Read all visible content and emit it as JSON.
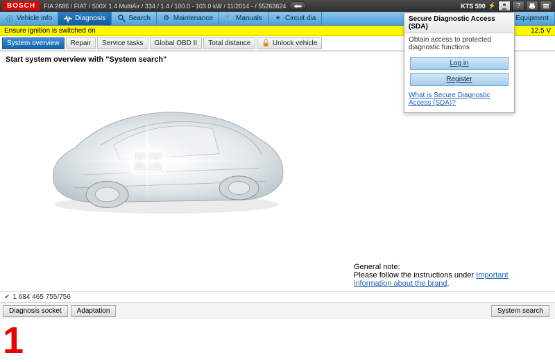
{
  "brand": "BOSCH",
  "vehicle_string": "FIA 2686 / FIAT / 500X 1.4 MultiAir / 334 / 1.4 / 100.0 - 103.0 kW / 11/2014 - / 55263624",
  "device": "KTS 590",
  "nav": {
    "vehicle_info": "Vehicle info",
    "diagnosis": "Diagnosis",
    "search": "Search",
    "maintenance": "Maintenance",
    "manuals": "Manuals",
    "circuit": "Circuit dia",
    "equipment": "Equipment"
  },
  "yellow": {
    "msg": "Ensure ignition is switched on",
    "voltage": "12.5 V"
  },
  "subtabs": {
    "system_overview": "System overview",
    "repair": "Repair",
    "service": "Service tasks",
    "obd": "Global OBD II",
    "distance": "Total distance",
    "unlock": "Unlock vehicle"
  },
  "prompt_text": "Start system overview with \"System search\"",
  "general_note": {
    "title": "General note:",
    "text": "Please follow the instructions under ",
    "link": "Important information about the brand",
    "dot": "."
  },
  "sda": {
    "header": "Secure Diagnostic Access (SDA)",
    "text": "Obtain access to protected diagnostic functions",
    "login": "Log in",
    "register": "Register",
    "link": "What is Secure Diagnostic Access (SDA)?"
  },
  "status_code": "1 684 465 755/756",
  "footer": {
    "diag_socket": "Diagnosis socket",
    "adaptation": "Adaptation",
    "sys_search": "System search"
  },
  "overlay_label": "1"
}
